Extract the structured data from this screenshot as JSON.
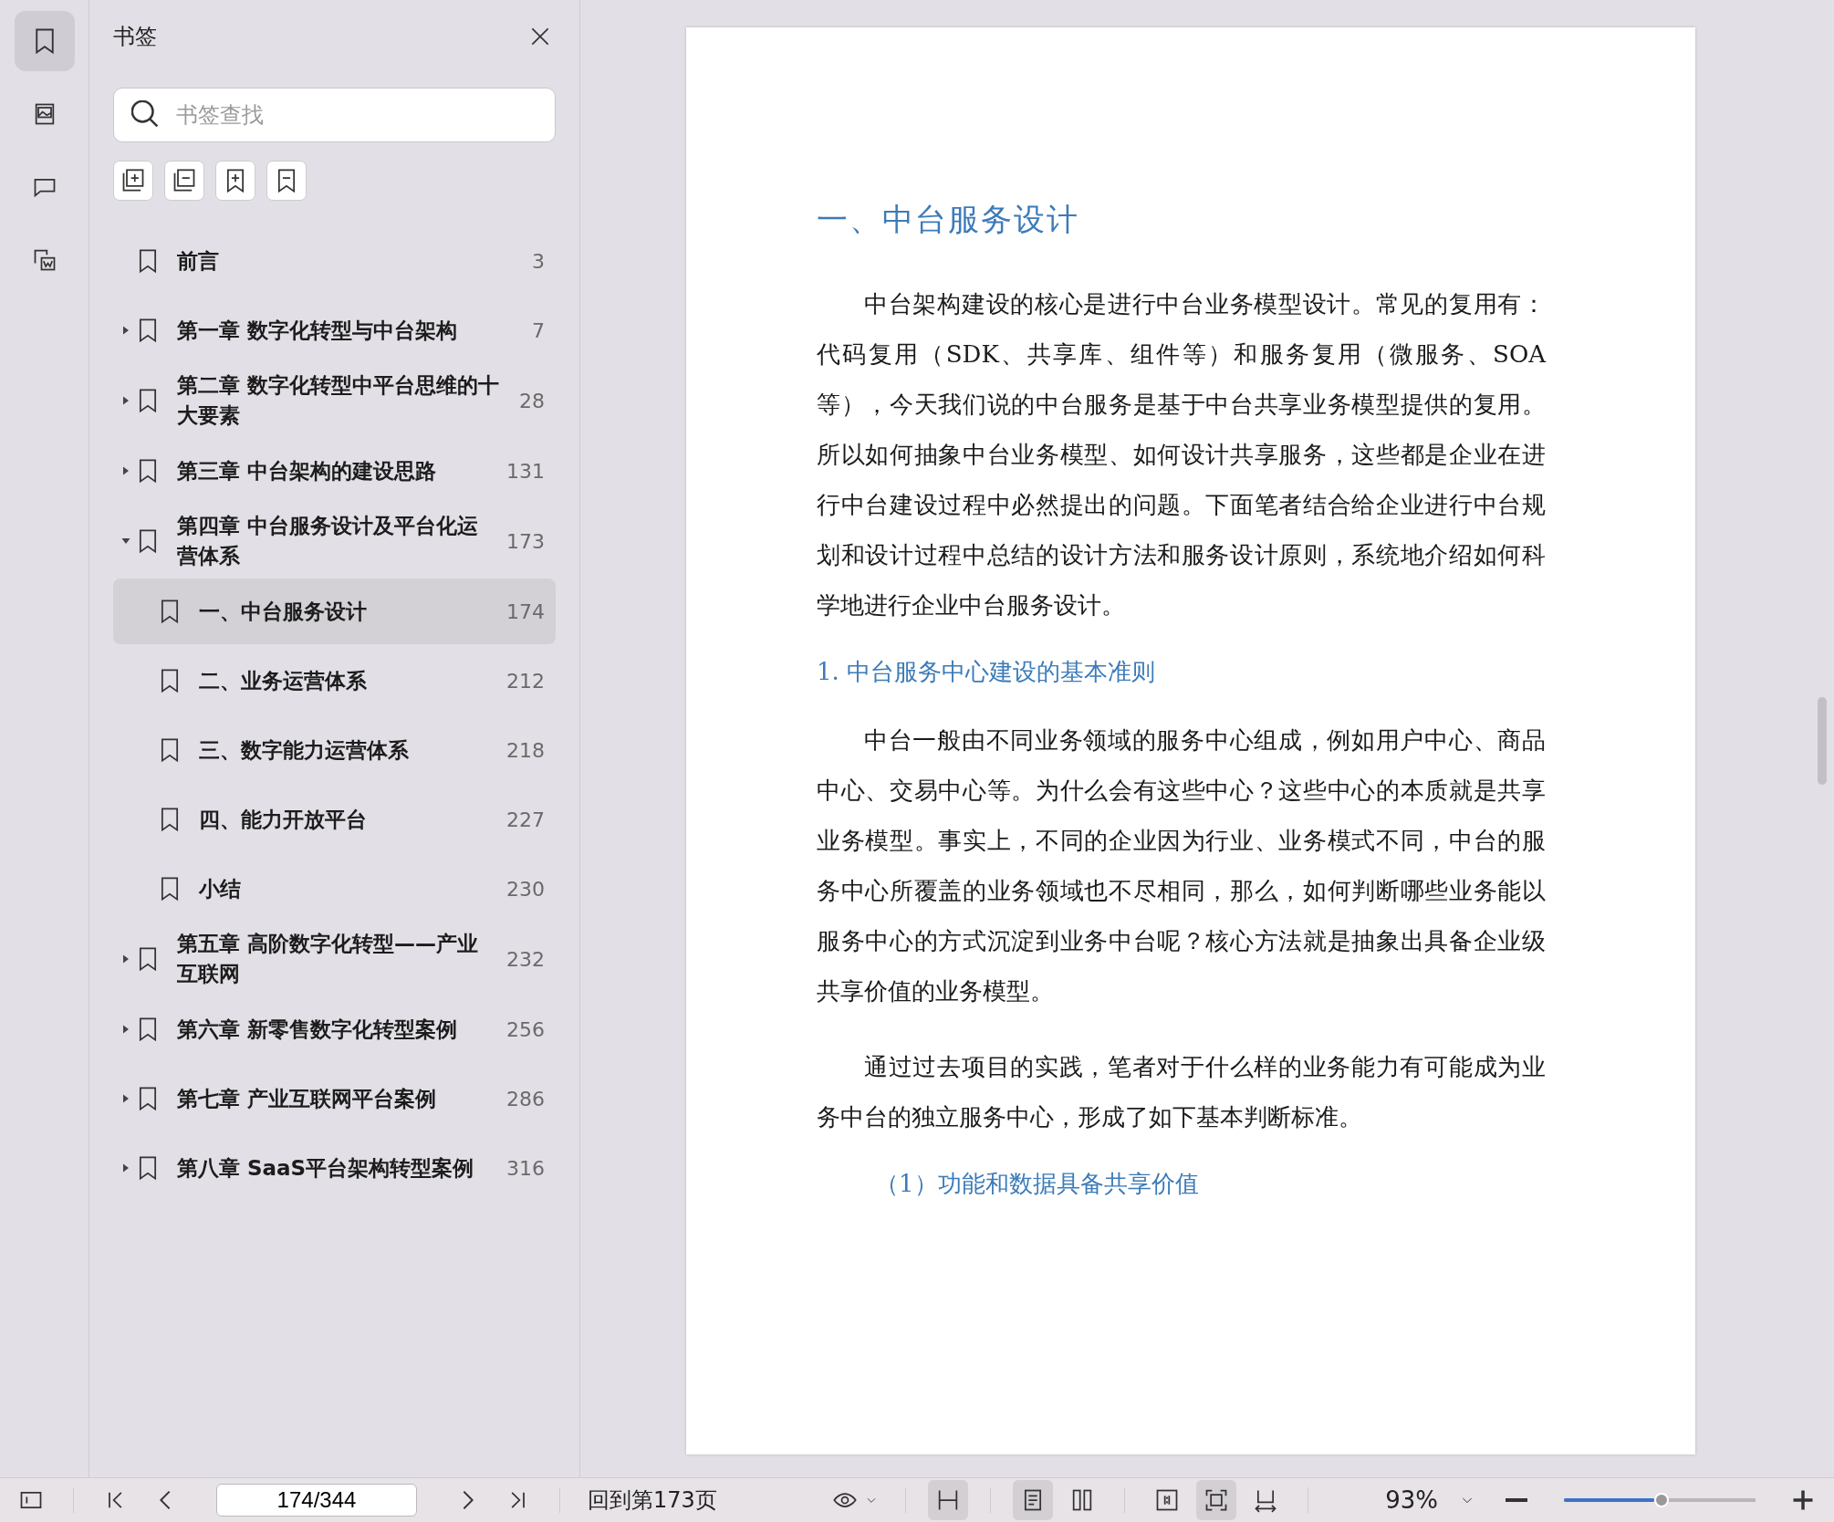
{
  "rail_tabs": [
    {
      "selected": true
    },
    {
      "selected": false
    },
    {
      "selected": false
    },
    {
      "selected": false
    }
  ],
  "sidebar": {
    "title": "书签",
    "search": {
      "placeholder": "书签查找"
    },
    "items": [
      {
        "label": "前言",
        "page": "3",
        "selected": false
      },
      {
        "label": "第一章 数字化转型与中台架构",
        "page": "7",
        "expanded": false,
        "selected": false
      },
      {
        "label": "第二章 数字化转型中平台思维的十大要素",
        "page": "28",
        "expanded": false,
        "selected": false
      },
      {
        "label": "第三章 中台架构的建设思路",
        "page": "131",
        "expanded": false,
        "selected": false
      },
      {
        "label": "第四章 中台服务设计及平台化运营体系",
        "page": "173",
        "expanded": true,
        "selected": false,
        "children": [
          {
            "label": "一、中台服务设计",
            "page": "174",
            "selected": true
          },
          {
            "label": "二、业务运营体系",
            "page": "212",
            "selected": false
          },
          {
            "label": "三、数字能力运营体系",
            "page": "218",
            "selected": false
          },
          {
            "label": "四、能力开放平台",
            "page": "227",
            "selected": false
          },
          {
            "label": "小结",
            "page": "230",
            "selected": false
          }
        ]
      },
      {
        "label": "第五章 高阶数字化转型——产业互联网",
        "page": "232",
        "expanded": false,
        "selected": false
      },
      {
        "label": "第六章 新零售数字化转型案例",
        "page": "256",
        "expanded": false,
        "selected": false
      },
      {
        "label": "第七章 产业互联网平台案例",
        "page": "286",
        "expanded": false,
        "selected": false
      },
      {
        "label": "第八章 SaaS平台架构转型案例",
        "page": "316",
        "expanded": false,
        "selected": false
      }
    ]
  },
  "document": {
    "blocks": [
      {
        "kind": "h1",
        "text": "一、中台服务设计"
      },
      {
        "kind": "p",
        "text": "中台架构建设的核心是进行中台业务模型设计。常见的复用有：代码复用（SDK、共享库、组件等）和服务复用（微服务、SOA等），今天我们说的中台服务是基于中台共享业务模型提供的复用。所以如何抽象中台业务模型、如何设计共享服务，这些都是企业在进行中台建设过程中必然提出的问题。下面笔者结合给企业进行中台规划和设计过程中总结的设计方法和服务设计原则，系统地介绍如何科学地进行企业中台服务设计。"
      },
      {
        "kind": "h2",
        "text": "1. 中台服务中心建设的基本准则"
      },
      {
        "kind": "p",
        "text": "中台一般由不同业务领域的服务中心组成，例如用户中心、商品中心、交易中心等。为什么会有这些中心？这些中心的本质就是共享业务模型。事实上，不同的企业因为行业、业务模式不同，中台的服务中心所覆盖的业务领域也不尽相同，那么，如何判断哪些业务能以服务中心的方式沉淀到业务中台呢？核心方法就是抽象出具备企业级共享价值的业务模型。"
      },
      {
        "kind": "p",
        "text": "通过过去项目的实践，笔者对于什么样的业务能力有可能成为业务中台的独立服务中心，形成了如下基本判断标准。"
      },
      {
        "kind": "h3",
        "text": "（1）功能和数据具备共享价值"
      }
    ]
  },
  "status_bar": {
    "page_field": {
      "value": "174/344"
    },
    "back_link": "回到第173页",
    "view_tools": [
      {
        "selected": true
      },
      {
        "selected": true
      },
      {
        "selected": false
      },
      {
        "selected": false
      },
      {
        "selected": true
      },
      {
        "selected": false
      }
    ],
    "zoom": {
      "value": "93%",
      "level": 0.47
    }
  }
}
